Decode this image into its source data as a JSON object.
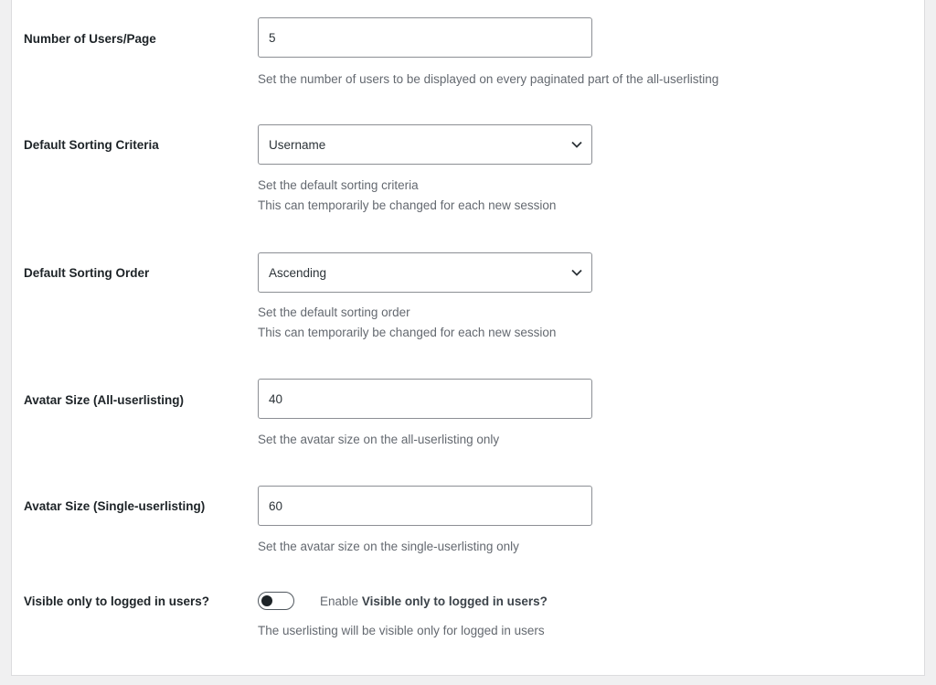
{
  "settings": [
    {
      "label": "Number of Users/Page",
      "type": "text",
      "value": "5",
      "descriptions": [
        "Set the number of users to be displayed on every paginated part of the all-userlisting"
      ]
    },
    {
      "label": "Default Sorting Criteria",
      "type": "select",
      "value": "Username",
      "icon": "chevron-down-icon",
      "descriptions": [
        "Set the default sorting criteria",
        "This can temporarily be changed for each new session"
      ]
    },
    {
      "label": "Default Sorting Order",
      "type": "select",
      "value": "Ascending",
      "icon": "chevron-down-icon",
      "descriptions": [
        "Set the default sorting order",
        "This can temporarily be changed for each new session"
      ]
    },
    {
      "label": "Avatar Size (All-userlisting)",
      "type": "text",
      "value": "40",
      "descriptions": [
        "Set the avatar size on the all-userlisting only"
      ]
    },
    {
      "label": "Avatar Size (Single-userlisting)",
      "type": "text",
      "value": "60",
      "descriptions": [
        "Set the avatar size on the single-userlisting only"
      ]
    },
    {
      "label": "Visible only to logged in users?",
      "type": "toggle",
      "checked": false,
      "toggle_prefix": "Enable",
      "toggle_label": "Visible only to logged in users?",
      "descriptions": [
        "The userlisting will be visible only for logged in users"
      ]
    }
  ]
}
